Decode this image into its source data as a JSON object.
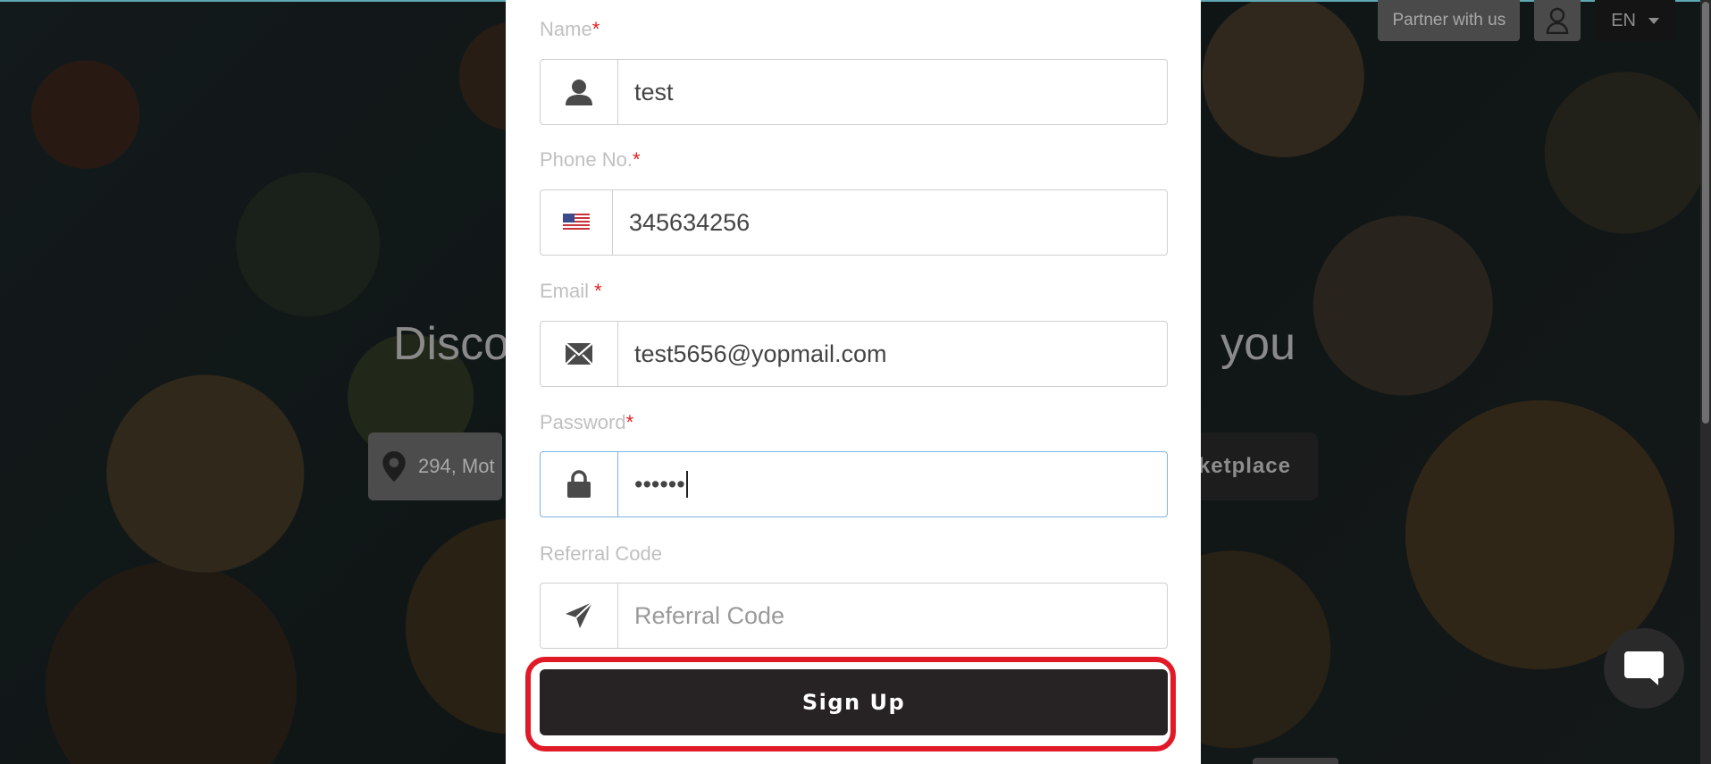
{
  "background": {
    "hero_title_left": "Disco",
    "hero_title_right": "you",
    "location_text": "294, Mot",
    "marketplace_label": "ketplace"
  },
  "header": {
    "partner_label": "Partner with us",
    "language": "EN"
  },
  "form": {
    "name": {
      "label": "Name",
      "required_mark": "*",
      "value": "test"
    },
    "phone": {
      "label": "Phone No.",
      "required_mark": "*",
      "value": "345634256",
      "country_flag": "us-flag-icon"
    },
    "email": {
      "label": "Email ",
      "required_mark": "*",
      "value": "test5656@yopmail.com"
    },
    "password": {
      "label": "Password",
      "required_mark": "*",
      "value": "••••••"
    },
    "referral": {
      "label": "Referral Code",
      "placeholder": "Referral Code"
    },
    "submit_label": "Sign Up"
  },
  "colors": {
    "required": "#e02020",
    "submit_bg": "#272224",
    "highlight": "#e01a27",
    "focus_border": "#7fb3e0"
  }
}
